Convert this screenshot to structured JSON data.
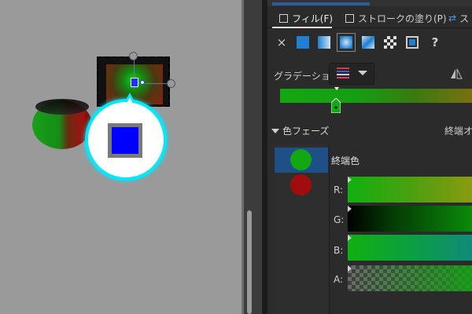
{
  "tabs": [
    {
      "label": "フィル(F)",
      "active": true
    },
    {
      "label": "ストロークの塗り(P)",
      "active": false
    },
    {
      "label": "ス",
      "active": false
    }
  ],
  "fill_type_icons": [
    "no-paint-icon",
    "flat-color-icon",
    "linear-gradient-icon",
    "radial-gradient-icon",
    "mesh-gradient-icon",
    "pattern-icon",
    "swatch-icon",
    "unset-icon"
  ],
  "fill_type_labels": {
    "none": "×",
    "unset": "?"
  },
  "gradient": {
    "label": "グラデーション:"
  },
  "phases": {
    "section_title": "色フェーズ",
    "end_option_label": "終端オ",
    "stops": [
      {
        "color": "#13a813",
        "selected": true
      },
      {
        "color": "#a00d0d",
        "selected": false
      }
    ],
    "selected_name": "終端色"
  },
  "channels": [
    {
      "label": "R:"
    },
    {
      "label": "G:"
    },
    {
      "label": "B:"
    },
    {
      "label": "A:"
    }
  ],
  "colors": {
    "accent": "#2b5d9c",
    "selection": "#1e4f87",
    "callout_border": "#00e8ff",
    "callout_square": "#0000ff",
    "green": "#13a813",
    "red": "#a00d0d"
  }
}
